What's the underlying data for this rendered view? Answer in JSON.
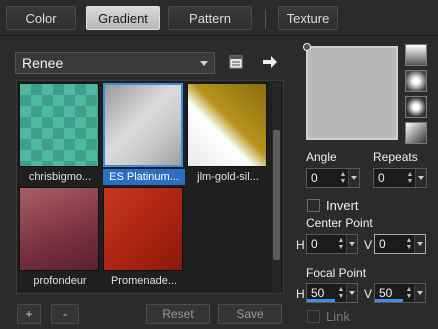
{
  "tabs": [
    {
      "label": "Color",
      "active": false
    },
    {
      "label": "Gradient",
      "active": true
    },
    {
      "label": "Pattern",
      "active": false
    },
    {
      "label": "Texture",
      "active": false
    }
  ],
  "library": {
    "selected": "Renee",
    "items": [
      {
        "label": "chrisbigmo...",
        "selected": false
      },
      {
        "label": "ES Platinum...",
        "selected": true
      },
      {
        "label": "jlm-gold-sil...",
        "selected": false
      },
      {
        "label": "profondeur",
        "selected": false
      },
      {
        "label": "Promenade...",
        "selected": false
      }
    ]
  },
  "buttons": {
    "add": "+",
    "remove": "-",
    "reset": "Reset",
    "save": "Save"
  },
  "settings": {
    "angle_label": "Angle",
    "angle_value": "0",
    "repeats_label": "Repeats",
    "repeats_value": "0",
    "invert_label": "Invert",
    "center_point_label": "Center Point",
    "center_h_label": "H",
    "center_h_value": "0",
    "center_v_label": "V",
    "center_v_value": "0",
    "focal_point_label": "Focal Point",
    "focal_h_label": "H",
    "focal_h_value": "50",
    "focal_v_label": "V",
    "focal_v_value": "50",
    "link_label": "Link"
  },
  "colors": {
    "accent": "#3a8ee0",
    "selection": "#2c6fc2"
  }
}
